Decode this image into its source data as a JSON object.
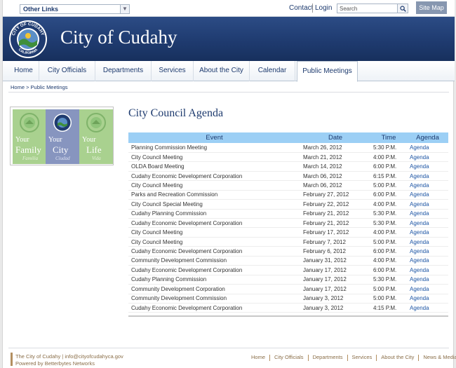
{
  "top_bar": {
    "other_links_label": "Other Links",
    "contact_label": "Contact",
    "login_label": "Login",
    "search_placeholder": "Search",
    "site_map_label": "Site Map"
  },
  "banner": {
    "title": "City of Cudahy",
    "seal_text_top": "CITY OF CUDAHY",
    "seal_text_bottom": "CALIFORNIA"
  },
  "nav": {
    "items": [
      {
        "label": "Home"
      },
      {
        "label": "City Officials"
      },
      {
        "label": "Departments"
      },
      {
        "label": "Services"
      },
      {
        "label": "About the City"
      },
      {
        "label": "Calendar"
      },
      {
        "label": "Public Meetings",
        "active": true
      }
    ]
  },
  "breadcrumb": "Home > Public Meetings",
  "promo": {
    "panels": [
      {
        "line1": "Your",
        "line2": "Family",
        "line3": "Familia"
      },
      {
        "line1": "Your",
        "line2": "City",
        "line3": "Ciudad"
      },
      {
        "line1": "Your",
        "line2": "Life",
        "line3": "Vida"
      }
    ]
  },
  "agenda": {
    "title": "City Council Agenda",
    "columns": [
      "Event",
      "Date",
      "Time",
      "Agenda"
    ],
    "rows": [
      [
        "Planning Commission Meeting",
        "March 26, 2012",
        "5:30 P.M.",
        "Agenda"
      ],
      [
        "City Council Meeting",
        "March 21, 2012",
        "4:00 P.M.",
        "Agenda"
      ],
      [
        "OLDA Board Meeting",
        "March 14, 2012",
        "6:00 P.M.",
        "Agenda"
      ],
      [
        "Cudahy Economic Development Corporation",
        "March 06, 2012",
        "6:15 P.M.",
        "Agenda"
      ],
      [
        "City Council Meeting",
        "March 06, 2012",
        "5:00 P.M.",
        "Agenda"
      ],
      [
        "Parks and Recreation Commission",
        "February 27, 2012",
        "6:00 P.M.",
        "Agenda"
      ],
      [
        "City Council Special Meeting",
        "February 22, 2012",
        "4:00 P.M.",
        "Agenda"
      ],
      [
        "Cudahy Planning Commission",
        "February 21, 2012",
        "5:30 P.M.",
        "Agenda"
      ],
      [
        "Cudahy Economic Development Corporation",
        "February 21, 2012",
        "5:30 P.M.",
        "Agenda"
      ],
      [
        "City Council Meeting",
        "February 17, 2012",
        "4:00 P.M.",
        "Agenda"
      ],
      [
        "City Council Meeting",
        "February 7, 2012",
        "5:00 P.M.",
        "Agenda"
      ],
      [
        "Cudahy Economic Development Corporation",
        "February 6, 2012",
        "6:00 P.M.",
        "Agenda"
      ],
      [
        "Community Development Commission",
        "January 31, 2012",
        "4:00 P.M.",
        "Agenda"
      ],
      [
        "Cudahy Economic Development Corporation",
        "January 17, 2012",
        "6:00 P.M.",
        "Agenda"
      ],
      [
        "Cudahy Planning Commission",
        "January 17, 2012",
        "5:30 P.M.",
        "Agenda"
      ],
      [
        "Community Development Corporation",
        "January 17, 2012",
        "5:00 P.M.",
        "Agenda"
      ],
      [
        "Community Development Commission",
        "January 3, 2012",
        "5:00 P.M.",
        "Agenda"
      ],
      [
        "Cudahy Economic Development Corporation",
        "January 3, 2012",
        "4:15 P.M.",
        "Agenda"
      ]
    ]
  },
  "footer": {
    "line1": "The City of Cudahy | info@cityofcudahyca.gov",
    "line2": "Powered by Betterbytes Networks",
    "links": [
      "Home",
      "City Officials",
      "Departments",
      "Services",
      "About the City",
      "News & Media"
    ]
  },
  "colors": {
    "banner_blue": "#1f3b70",
    "table_header": "#9ccff5",
    "link_blue": "#1d55a4",
    "footer_brown": "#8a6e48"
  }
}
